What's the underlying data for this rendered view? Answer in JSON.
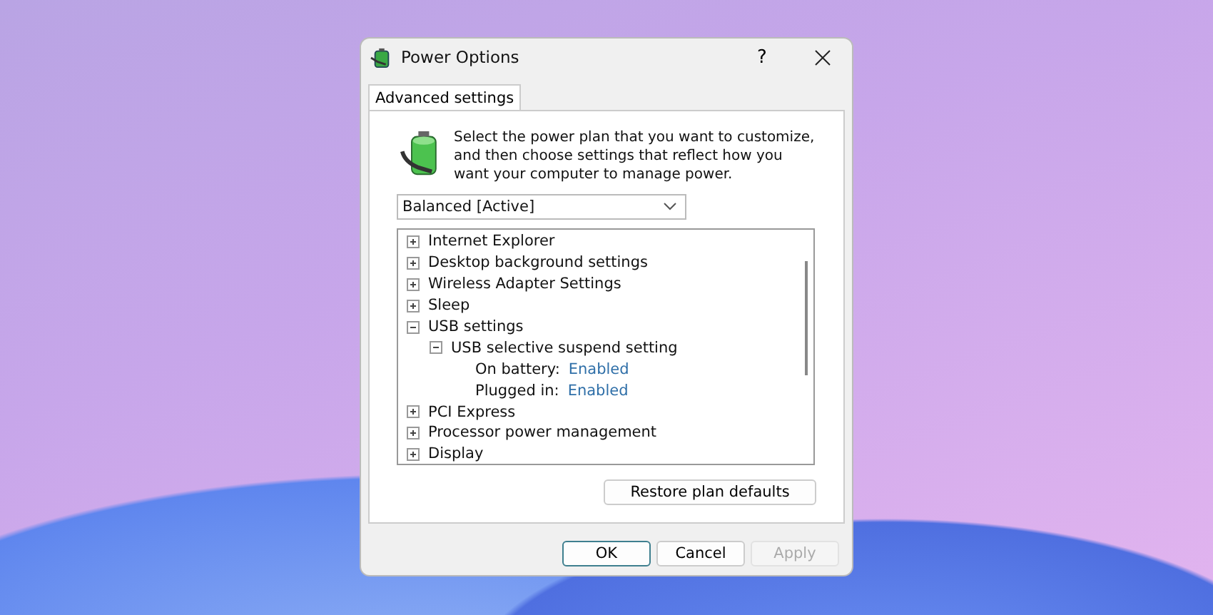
{
  "window": {
    "title": "Power Options",
    "help": "?"
  },
  "tabs": [
    {
      "label": "Advanced settings",
      "selected": true
    }
  ],
  "intro": "Select the power plan that you want to customize, and then choose settings that reflect how you want your computer to manage power.",
  "plan_dropdown": {
    "value": "Balanced [Active]"
  },
  "tree": [
    {
      "label": "Internet Explorer",
      "expanded": false
    },
    {
      "label": "Desktop background settings",
      "expanded": false
    },
    {
      "label": "Wireless Adapter Settings",
      "expanded": false
    },
    {
      "label": "Sleep",
      "expanded": false
    },
    {
      "label": "USB settings",
      "expanded": true,
      "children": [
        {
          "label": "USB selective suspend setting",
          "expanded": true,
          "children": [
            {
              "kind": "setting",
              "label": "On battery:",
              "value": "Enabled"
            },
            {
              "kind": "setting",
              "label": "Plugged in:",
              "value": "Enabled"
            }
          ]
        }
      ]
    },
    {
      "label": "PCI Express",
      "expanded": false
    },
    {
      "label": "Processor power management",
      "expanded": false
    },
    {
      "label": "Display",
      "expanded": false
    }
  ],
  "restore_button": "Restore plan defaults",
  "buttons": [
    {
      "label": "OK",
      "default": true,
      "disabled": false
    },
    {
      "label": "Cancel",
      "default": false,
      "disabled": false
    },
    {
      "label": "Apply",
      "default": false,
      "disabled": true
    }
  ]
}
